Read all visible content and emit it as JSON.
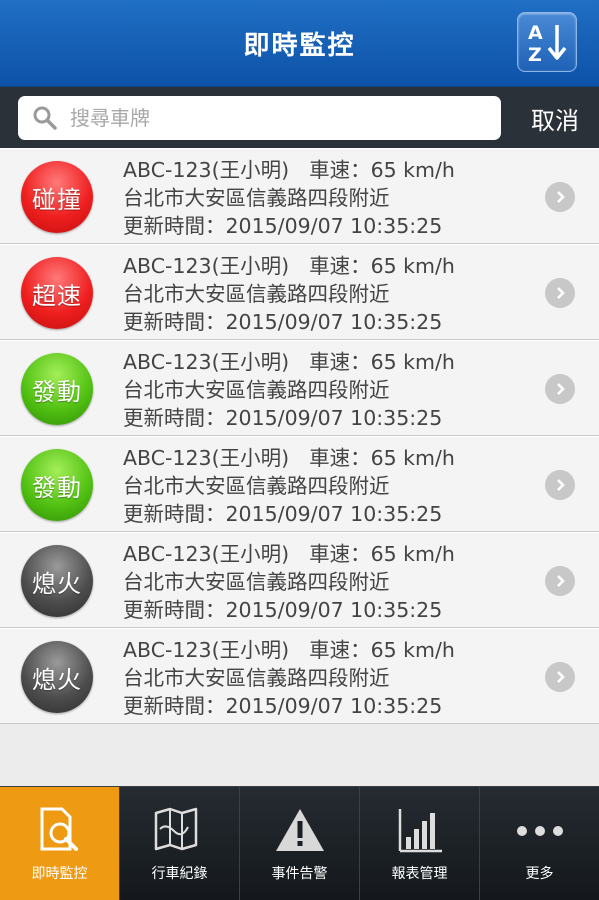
{
  "header": {
    "title": "即時監控",
    "sort_label": "A↓Z"
  },
  "search": {
    "placeholder": "搜尋車牌",
    "cancel_label": "取消"
  },
  "vehicles": [
    {
      "status": "碰撞",
      "color": "red",
      "plate": "ABC-123",
      "driver": "(王小明)",
      "speed_label": "車速：65 km/h",
      "address": "台北市大安區信義路四段附近",
      "updated": "更新時間：2015/09/07 10:35:25"
    },
    {
      "status": "超速",
      "color": "red",
      "plate": "ABC-123",
      "driver": "(王小明)",
      "speed_label": "車速：65 km/h",
      "address": "台北市大安區信義路四段附近",
      "updated": "更新時間：2015/09/07 10:35:25"
    },
    {
      "status": "發動",
      "color": "green",
      "plate": "ABC-123",
      "driver": "(王小明)",
      "speed_label": "車速：65 km/h",
      "address": "台北市大安區信義路四段附近",
      "updated": "更新時間：2015/09/07 10:35:25"
    },
    {
      "status": "發動",
      "color": "green",
      "plate": "ABC-123",
      "driver": "(王小明)",
      "speed_label": "車速：65 km/h",
      "address": "台北市大安區信義路四段附近",
      "updated": "更新時間：2015/09/07 10:35:25"
    },
    {
      "status": "熄火",
      "color": "gray",
      "plate": "ABC-123",
      "driver": "(王小明)",
      "speed_label": "車速：65 km/h",
      "address": "台北市大安區信義路四段附近",
      "updated": "更新時間：2015/09/07 10:35:25"
    },
    {
      "status": "熄火",
      "color": "gray",
      "plate": "ABC-123",
      "driver": "(王小明)",
      "speed_label": "車速：65 km/h",
      "address": "台北市大安區信義路四段附近",
      "updated": "更新時間：2015/09/07 10:35:25"
    }
  ],
  "tabs": [
    {
      "label": "即時監控",
      "icon": "monitor-search-icon",
      "active": true
    },
    {
      "label": "行車紀錄",
      "icon": "map-icon",
      "active": false
    },
    {
      "label": "事件告警",
      "icon": "warning-icon",
      "active": false
    },
    {
      "label": "報表管理",
      "icon": "bar-chart-icon",
      "active": false
    },
    {
      "label": "更多",
      "icon": "more-icon",
      "active": false
    }
  ],
  "colors": {
    "header": "#0d52a8",
    "active_tab": "#ee9a12",
    "red": "#ef1f1f",
    "green": "#53c213",
    "gray": "#4e4e4e"
  }
}
